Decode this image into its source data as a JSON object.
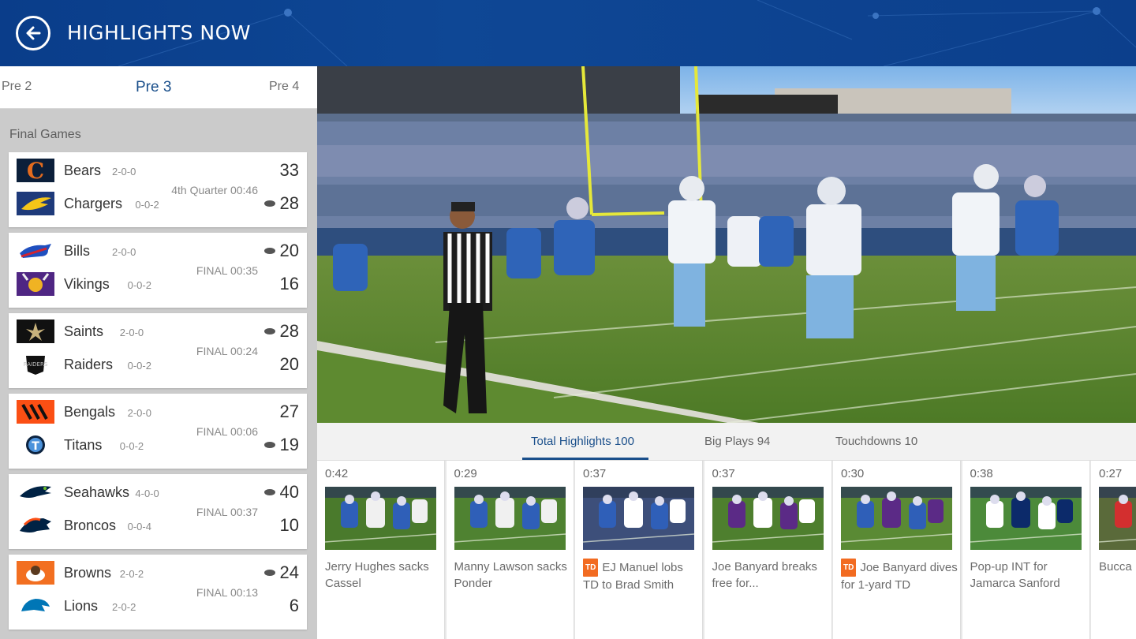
{
  "header": {
    "title": "HIGHLIGHTS NOW"
  },
  "weeks": {
    "prev": "Pre 2",
    "current": "Pre 3",
    "next": "Pre 4"
  },
  "section_title": "Final Games",
  "games": [
    {
      "home": {
        "name": "Bears",
        "record": "2-0-0",
        "score": "33",
        "possession": false
      },
      "away": {
        "name": "Chargers",
        "record": "0-0-2",
        "score": "28",
        "possession": true
      },
      "status": "4th Quarter 00:46"
    },
    {
      "home": {
        "name": "Bills",
        "record": "2-0-0",
        "score": "20",
        "possession": true
      },
      "away": {
        "name": "Vikings",
        "record": "0-0-2",
        "score": "16",
        "possession": false
      },
      "status": "FINAL 00:35"
    },
    {
      "home": {
        "name": "Saints",
        "record": "2-0-0",
        "score": "28",
        "possession": true
      },
      "away": {
        "name": "Raiders",
        "record": "0-0-2",
        "score": "20",
        "possession": false
      },
      "status": "FINAL 00:24"
    },
    {
      "home": {
        "name": "Bengals",
        "record": "2-0-0",
        "score": "27",
        "possession": false
      },
      "away": {
        "name": "Titans",
        "record": "0-0-2",
        "score": "19",
        "possession": true
      },
      "status": "FINAL 00:06"
    },
    {
      "home": {
        "name": "Seahawks",
        "record": "4-0-0",
        "score": "40",
        "possession": true
      },
      "away": {
        "name": "Broncos",
        "record": "0-0-4",
        "score": "10",
        "possession": false
      },
      "status": "FINAL 00:37"
    },
    {
      "home": {
        "name": "Browns",
        "record": "2-0-2",
        "score": "24",
        "possession": true
      },
      "away": {
        "name": "Lions",
        "record": "2-0-2",
        "score": "6",
        "possession": false
      },
      "status": "FINAL 00:13"
    }
  ],
  "tabs": [
    {
      "label": "Total Highlights 100",
      "active": true
    },
    {
      "label": "Big Plays 94",
      "active": false
    },
    {
      "label": "Touchdowns 10",
      "active": false
    }
  ],
  "clips": [
    {
      "duration": "0:42",
      "caption": "Jerry Hughes sacks Cassel",
      "td": false
    },
    {
      "duration": "0:29",
      "caption": "Manny Lawson sacks Ponder",
      "td": false
    },
    {
      "duration": "0:37",
      "caption": "EJ Manuel lobs TD to Brad Smith",
      "td": true
    },
    {
      "duration": "0:37",
      "caption": "Joe Banyard breaks free for...",
      "td": false
    },
    {
      "duration": "0:30",
      "caption": "Joe Banyard dives for 1-yard TD",
      "td": true
    },
    {
      "duration": "0:38",
      "caption": "Pop-up INT for Jamarca Sanford",
      "td": false
    },
    {
      "duration": "0:27",
      "caption": "Bucca Doug M",
      "td": false
    }
  ],
  "td_badge": "TD",
  "colors": {
    "header": "#0e4795",
    "accent": "#1a4f8b",
    "td": "#f26b21",
    "field": "#4f7d2a"
  }
}
